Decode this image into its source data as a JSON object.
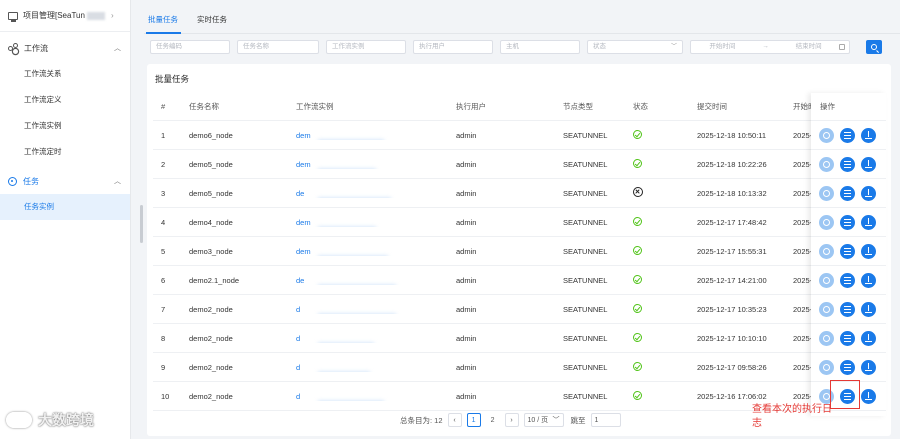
{
  "sidebar": {
    "project_label": "项目管理[SeaTun",
    "menu": [
      {
        "label": "工作流",
        "items": [
          "工作流关系",
          "工作流定义",
          "工作流实例",
          "工作流定时"
        ]
      },
      {
        "label": "任务",
        "items": [
          "任务实例"
        ],
        "selected": "任务实例"
      }
    ]
  },
  "tabs": [
    "批量任务",
    "实时任务"
  ],
  "filters": {
    "task_code": "任务编码",
    "task_name": "任务名称",
    "workflow_instance": "工作流实例",
    "exec_user": "执行用户",
    "host": "主机",
    "status": "状态",
    "start_time": "开始时间",
    "end_time": "结束时间",
    "date_sep": "→"
  },
  "card_title": "批量任务",
  "columns": {
    "idx": "#",
    "name": "任务名称",
    "instance": "工作流实例",
    "user": "执行用户",
    "node_type": "节点类型",
    "status": "状态",
    "submit_time": "提交时间",
    "start_time": "开始时",
    "ops": "操作"
  },
  "rows": [
    {
      "idx": "1",
      "name": "demo6_node",
      "inst_head": "dem",
      "inst_tail": "字段-同",
      "user": "admin",
      "type": "SEATUNNEL",
      "status": "success",
      "submit": "2025-12-18 10:50:11",
      "start": "2025-"
    },
    {
      "idx": "2",
      "name": "demo5_node",
      "inst_head": "dem",
      "inst_tail": "日增字段-同",
      "user": "admin",
      "type": "SEATUNNEL",
      "status": "success",
      "submit": "2025-12-18 10:22:26",
      "start": "2025-"
    },
    {
      "idx": "3",
      "name": "demo5_node",
      "inst_head": "de",
      "inst_tail": "增字段-同",
      "user": "admin",
      "type": "SEATUNNEL",
      "status": "failed",
      "submit": "2025-12-18 10:13:32",
      "start": "2025-"
    },
    {
      "idx": "4",
      "name": "demo4_node",
      "inst_head": "dem",
      "inst_tail": "-自增字段",
      "user": "admin",
      "type": "SEATUNNEL",
      "status": "success",
      "submit": "2025-12-17 17:48:42",
      "start": "2025-"
    },
    {
      "idx": "5",
      "name": "demo3_node",
      "inst_head": "dem",
      "inst_tail": "(关闭) -20",
      "user": "admin",
      "type": "SEATUNNEL",
      "status": "success",
      "submit": "2025-12-17 15:55:31",
      "start": "2025-"
    },
    {
      "idx": "6",
      "name": "demo2.1_node",
      "inst_head": "de",
      "inst_tail": "(1段)",
      "user": "admin",
      "type": "SEATUNNEL",
      "status": "success",
      "submit": "2025-12-17 14:21:00",
      "start": "2025-"
    },
    {
      "idx": "7",
      "name": "demo2_node",
      "inst_head": "d",
      "inst_tail": "理删除 + 大",
      "user": "admin",
      "type": "SEATUNNEL",
      "status": "success",
      "submit": "2025-12-17 10:35:23",
      "start": "2025-"
    },
    {
      "idx": "8",
      "name": "demo2_node",
      "inst_head": "d",
      "inst_tail": "集-物理删除 + 大",
      "user": "admin",
      "type": "SEATUNNEL",
      "status": "success",
      "submit": "2025-12-17 10:10:10",
      "start": "2025-"
    },
    {
      "idx": "9",
      "name": "demo2_node",
      "inst_head": "d",
      "inst_tail": "采集-物理删除 + 大",
      "user": "admin",
      "type": "SEATUNNEL",
      "status": "success",
      "submit": "2025-12-17 09:58:26",
      "start": "2025-"
    },
    {
      "idx": "10",
      "name": "demo2_node",
      "inst_head": "d",
      "inst_tail": "物理删除 + 大",
      "user": "admin",
      "type": "SEATUNNEL",
      "status": "success",
      "submit": "2025-12-16 17:06:02",
      "start": "2025-"
    }
  ],
  "pagination": {
    "total": "总条目为: 12",
    "pages": [
      "1",
      "2"
    ],
    "current": "1",
    "page_size": "10 / 页",
    "jump_label": "跳至",
    "jump_value": "1"
  },
  "annotation": "查看本次的执行日志",
  "watermark": "大数跨境",
  "colors": {
    "accent": "#1a7ae8",
    "success": "#52c41a",
    "annotation": "#e53935"
  }
}
